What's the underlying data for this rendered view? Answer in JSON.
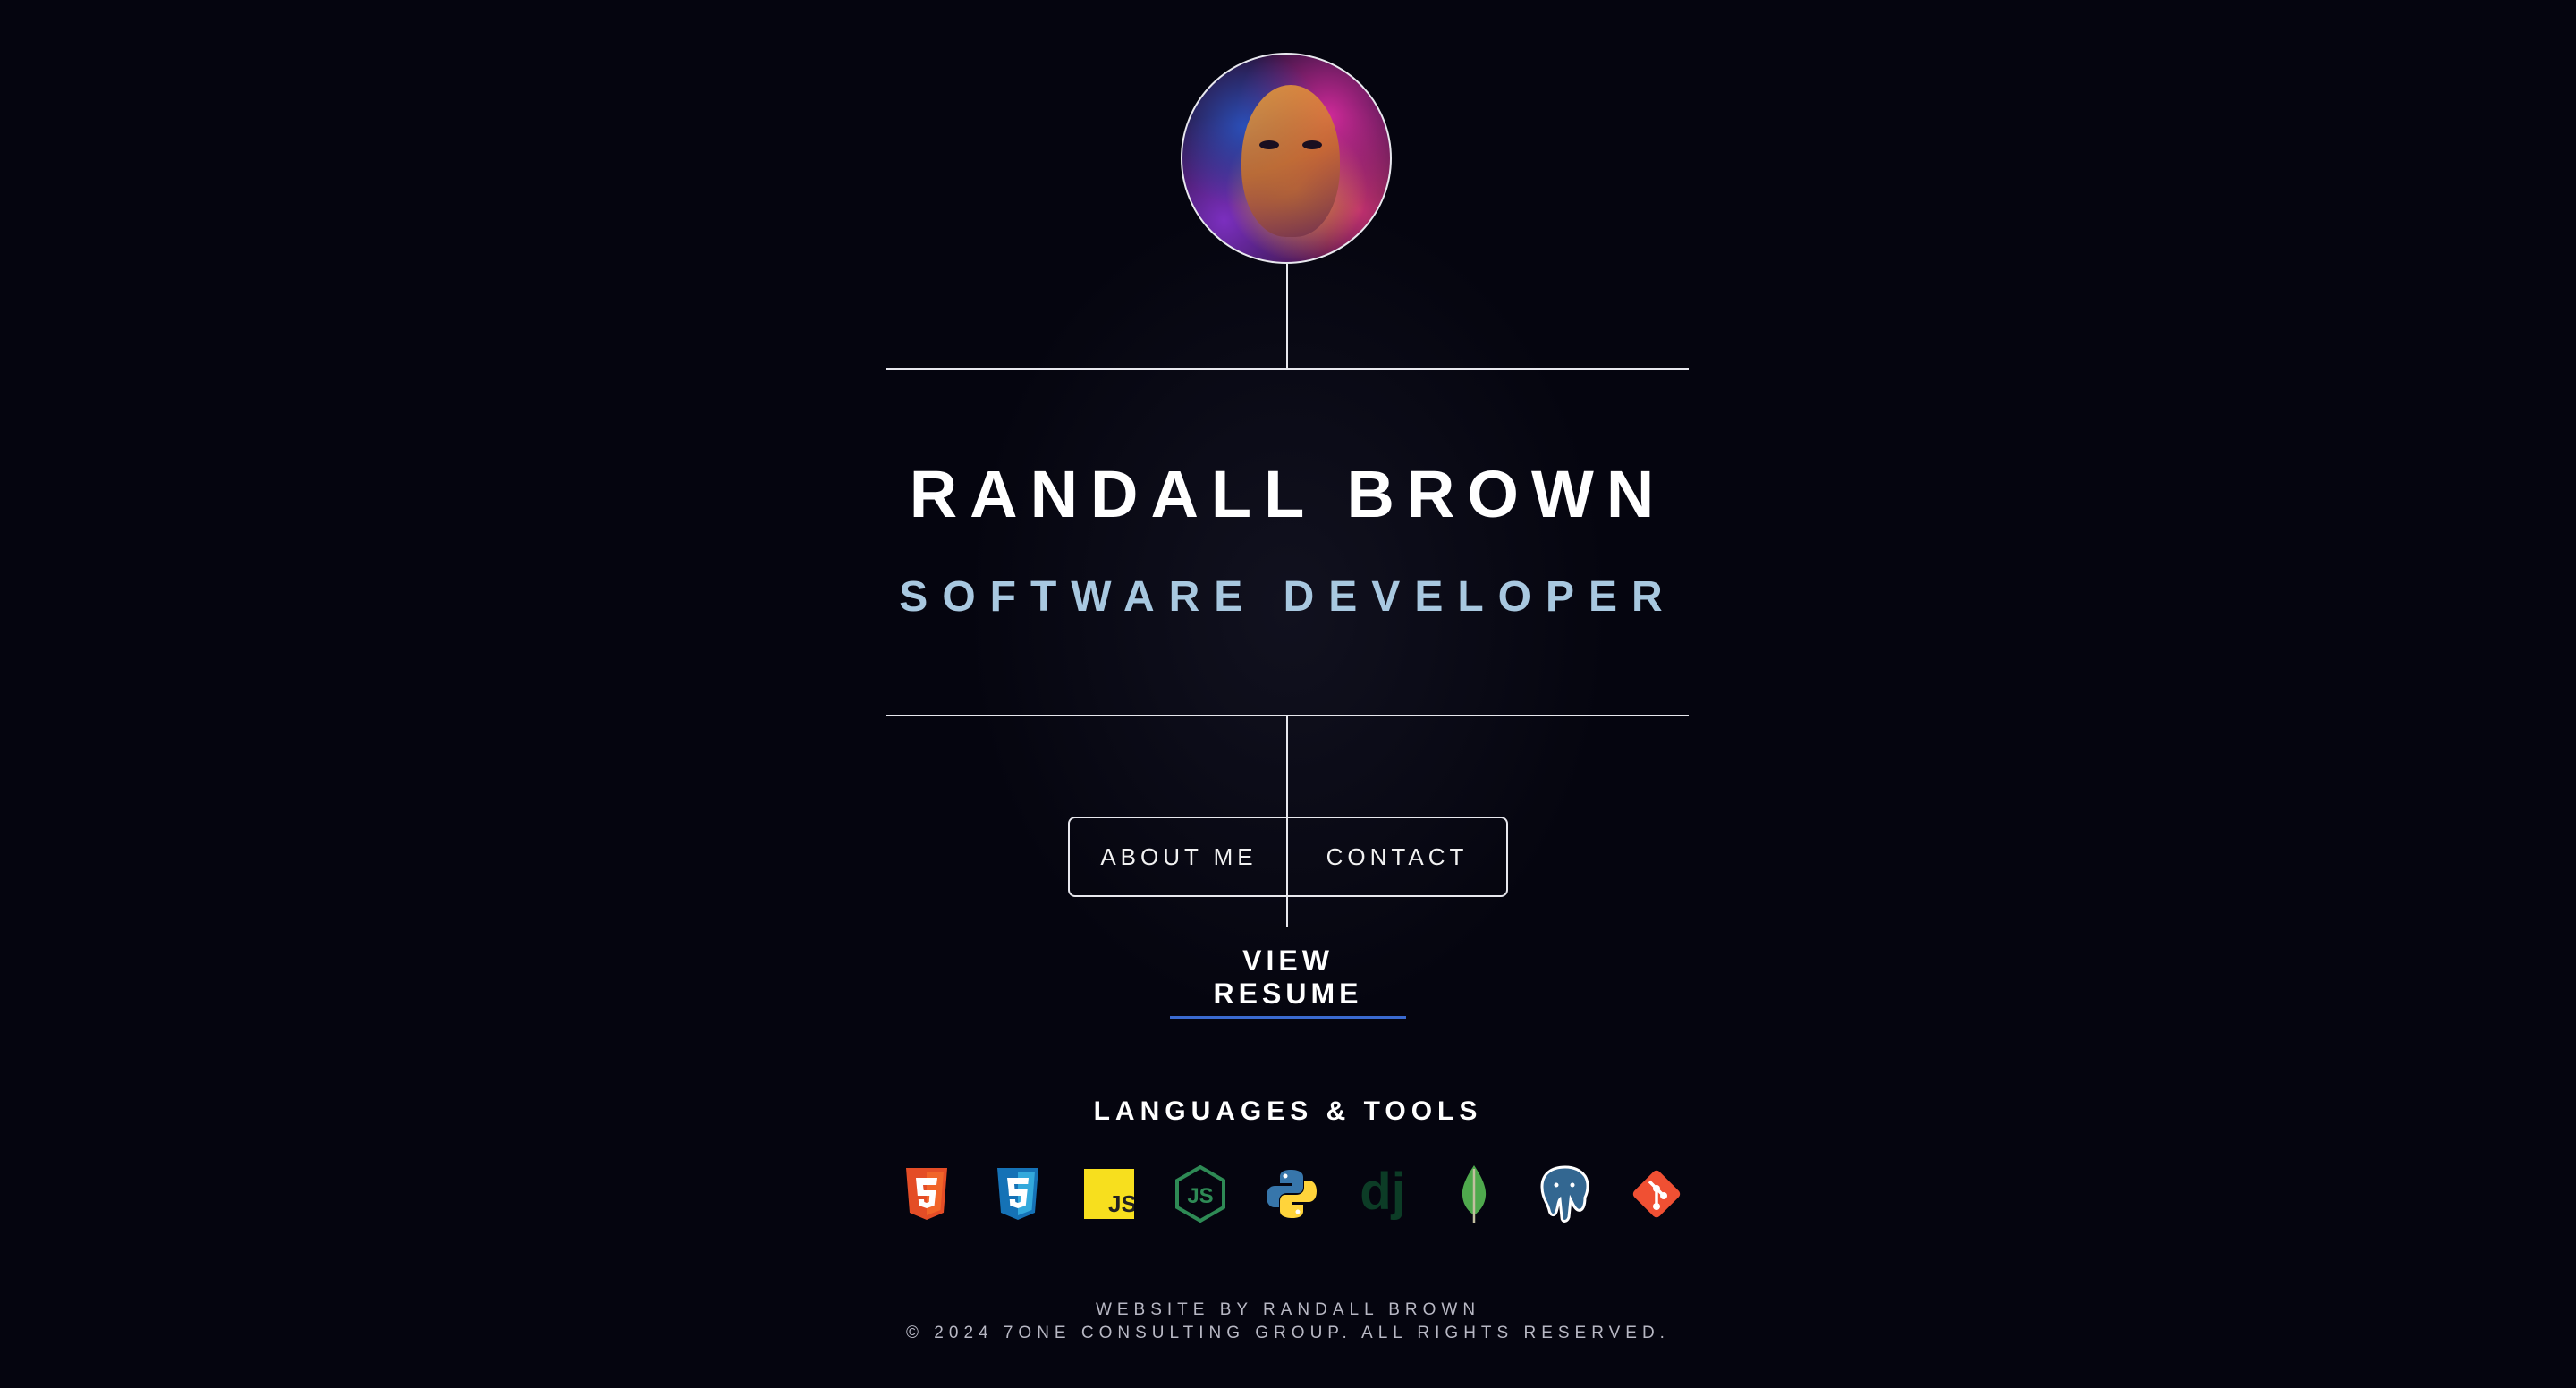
{
  "profile": {
    "name": "RANDALL BROWN",
    "title": "SOFTWARE DEVELOPER"
  },
  "nav": {
    "about_label": "ABOUT ME",
    "contact_label": "CONTACT",
    "resume_label": "VIEW RESUME"
  },
  "tools": {
    "heading": "LANGUAGES & TOOLS",
    "icons": [
      "html5-icon",
      "css3-icon",
      "javascript-icon",
      "nodejs-icon",
      "python-icon",
      "django-icon",
      "mongodb-icon",
      "postgresql-icon",
      "git-icon"
    ]
  },
  "footer": {
    "credit": "WEBSITE BY RANDALL BROWN",
    "copyright": "© 2024 7ONE CONSULTING GROUP. ALL RIGHTS RESERVED."
  },
  "colors": {
    "background": "#05050f",
    "accent_role": "#a8c8e0",
    "resume_underline": "#3a6ad0"
  }
}
